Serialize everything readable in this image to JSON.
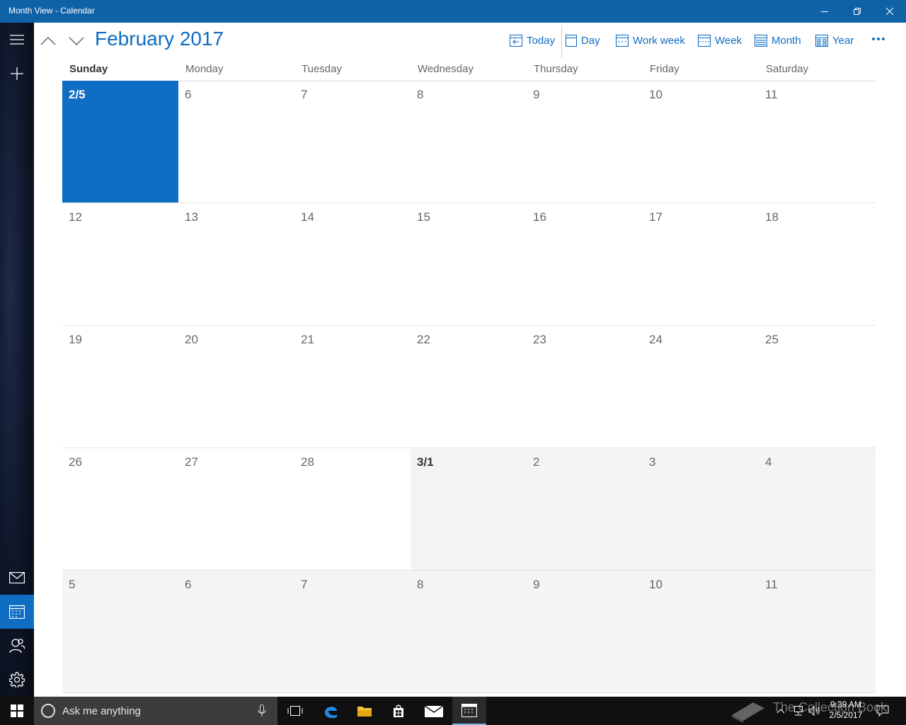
{
  "window": {
    "title": "Month View - Calendar"
  },
  "header": {
    "month_title": "February 2017",
    "toolbar": {
      "today": "Today",
      "day": "Day",
      "work_week": "Work week",
      "week": "Week",
      "month": "Month",
      "year": "Year"
    }
  },
  "weekdays": [
    "Sunday",
    "Monday",
    "Tuesday",
    "Wednesday",
    "Thursday",
    "Friday",
    "Saturday"
  ],
  "weeks": [
    [
      "2/5",
      "6",
      "7",
      "8",
      "9",
      "10",
      "11"
    ],
    [
      "12",
      "13",
      "14",
      "15",
      "16",
      "17",
      "18"
    ],
    [
      "19",
      "20",
      "21",
      "22",
      "23",
      "24",
      "25"
    ],
    [
      "26",
      "27",
      "28",
      "3/1",
      "2",
      "3",
      "4"
    ],
    [
      "5",
      "6",
      "7",
      "8",
      "9",
      "10",
      "11"
    ]
  ],
  "today_label": "2/5",
  "taskbar": {
    "search_placeholder": "Ask me anything",
    "time": "9:39 AM",
    "date": "2/5/2017",
    "watermark": "The Collection Book"
  },
  "colors": {
    "accent": "#0f6dc3",
    "titlebar": "#1062a7",
    "other_month_bg": "#f4f4f4"
  }
}
